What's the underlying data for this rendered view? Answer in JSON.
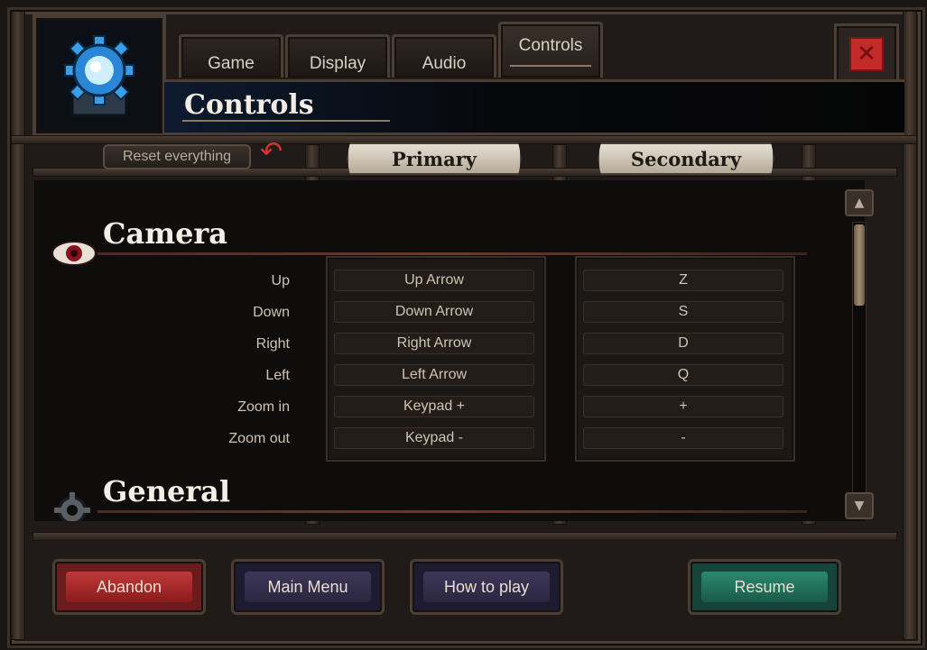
{
  "tabs": [
    {
      "label": "Game",
      "active": false
    },
    {
      "label": "Display",
      "active": false
    },
    {
      "label": "Audio",
      "active": false
    },
    {
      "label": "Controls",
      "active": true
    }
  ],
  "header": {
    "title": "Controls",
    "icon": "gear-icon"
  },
  "toolbar": {
    "reset_label": "Reset everything",
    "reset_icon": "undo-icon"
  },
  "columns": {
    "primary": "Primary",
    "secondary": "Secondary"
  },
  "sections": {
    "camera": {
      "title": "Camera",
      "icon": "eye-icon",
      "rows": [
        {
          "action": "Up",
          "primary": "Up Arrow",
          "secondary": "Z"
        },
        {
          "action": "Down",
          "primary": "Down Arrow",
          "secondary": "S"
        },
        {
          "action": "Right",
          "primary": "Right Arrow",
          "secondary": "D"
        },
        {
          "action": "Left",
          "primary": "Left Arrow",
          "secondary": "Q"
        },
        {
          "action": "Zoom in",
          "primary": "Keypad +",
          "secondary": "+"
        },
        {
          "action": "Zoom out",
          "primary": "Keypad -",
          "secondary": "-"
        }
      ]
    },
    "general": {
      "title": "General",
      "icon": "cog-icon"
    }
  },
  "footer": {
    "abandon": "Abandon",
    "main_menu": "Main Menu",
    "how_to_play": "How to play",
    "resume": "Resume"
  },
  "colors": {
    "abandon": "#a12a2a",
    "neutral": "#2a2540",
    "resume": "#1e6a56",
    "close": "#c52a2a"
  }
}
